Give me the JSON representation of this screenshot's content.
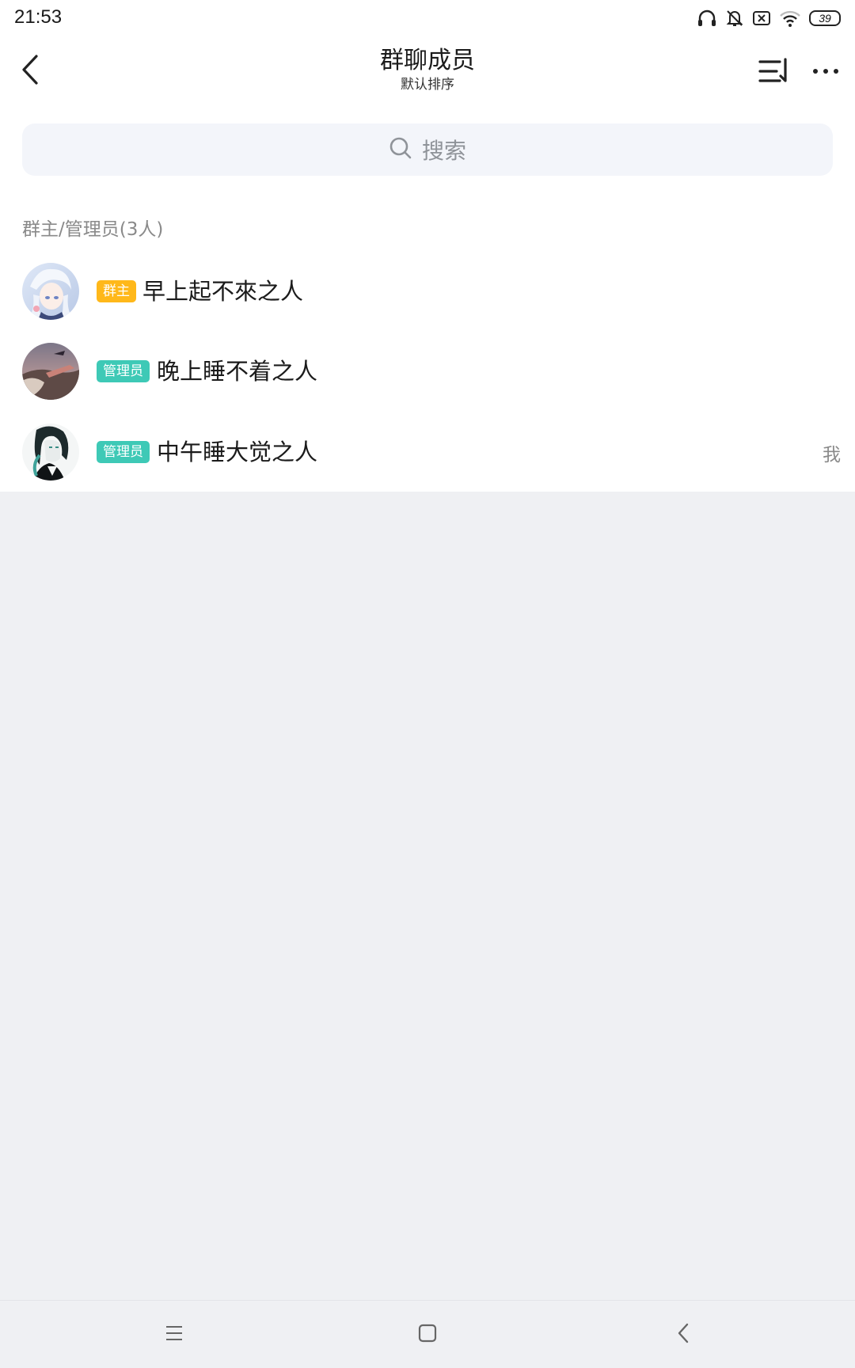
{
  "status_bar": {
    "time": "21:53",
    "battery": "39",
    "icons": [
      "headphones-icon",
      "bell-muted-icon",
      "sim-off-icon",
      "wifi-icon",
      "battery-icon"
    ]
  },
  "header": {
    "title": "群聊成员",
    "subtitle": "默认排序",
    "back_icon": "back-arrow-icon",
    "sort_icon": "sort-icon",
    "more_icon": "more-dots-icon"
  },
  "search": {
    "placeholder": "搜索",
    "icon": "search-icon"
  },
  "section": {
    "title": "群主/管理员(3人)"
  },
  "members": [
    {
      "badge": "群主",
      "badge_type": "owner",
      "name": "早上起不來之人",
      "is_me": false
    },
    {
      "badge": "管理员",
      "badge_type": "admin",
      "name": "晚上睡不着之人",
      "is_me": false
    },
    {
      "badge": "管理员",
      "badge_type": "admin",
      "name": "中午睡大觉之人",
      "is_me": true,
      "me_label": "我"
    }
  ],
  "colors": {
    "owner_badge": "#ffb81a",
    "admin_badge": "#3ec9b6",
    "background": "#eff0f3",
    "search_bg": "#f3f5fa"
  },
  "nav_bar": {
    "icons": [
      "menu-icon",
      "home-square-icon",
      "back-chevron-icon"
    ]
  }
}
